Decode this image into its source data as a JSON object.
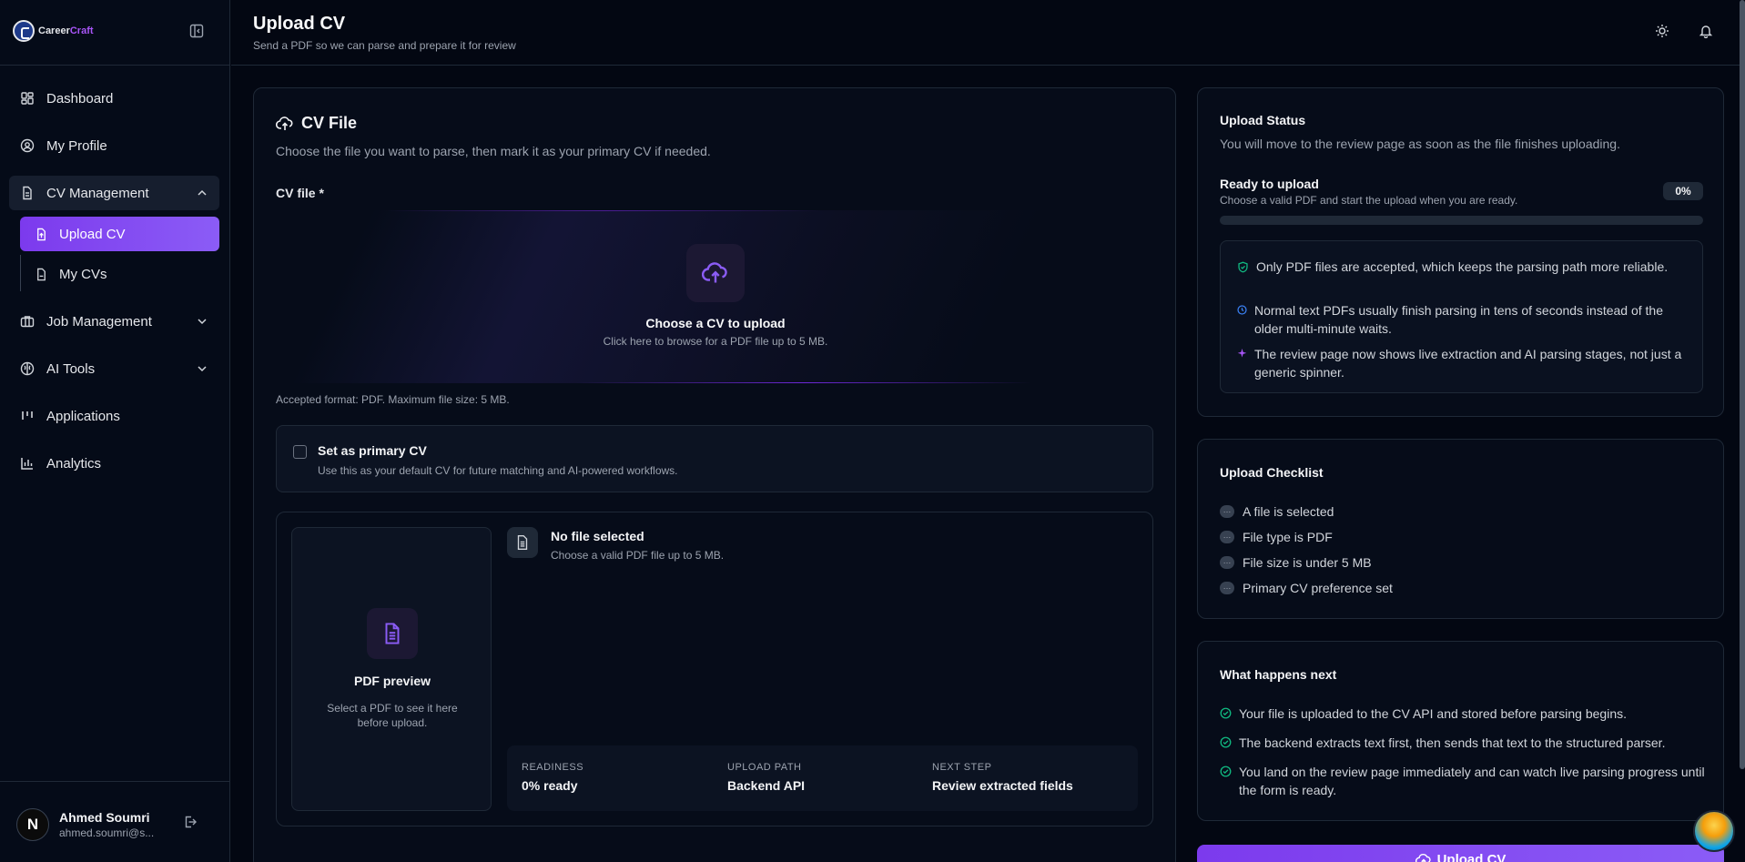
{
  "brand": {
    "name_part1": "Career",
    "name_part2": "Craft"
  },
  "sidebar": {
    "nav": {
      "dashboard": "Dashboard",
      "profile": "My Profile",
      "cv_management": "CV Management",
      "upload_cv": "Upload CV",
      "my_cvs": "My CVs",
      "job_management": "Job Management",
      "ai_tools": "AI Tools",
      "applications": "Applications",
      "analytics": "Analytics"
    },
    "user": {
      "initial": "N",
      "name": "Ahmed Soumri",
      "email": "ahmed.soumri@s..."
    }
  },
  "header": {
    "title": "Upload CV",
    "subtitle": "Send a PDF so we can parse and prepare it for review"
  },
  "cv_file": {
    "title": "CV File",
    "description": "Choose the file you want to parse, then mark it as your primary CV if needed.",
    "label": "CV file *",
    "drop_title": "Choose a CV to upload",
    "drop_sub": "Click here to browse for a PDF file up to 5 MB.",
    "accepted": "Accepted format: PDF. Maximum file size: 5 MB.",
    "primary_title": "Set as primary CV",
    "primary_sub": "Use this as your default CV for future matching and AI-powered workflows.",
    "primary_checked": false,
    "preview_title": "PDF preview",
    "preview_sub": "Select a PDF to see it here before upload.",
    "nofile_title": "No file selected",
    "nofile_sub": "Choose a valid PDF file up to 5 MB.",
    "stats": [
      {
        "label": "READINESS",
        "value": "0% ready"
      },
      {
        "label": "UPLOAD PATH",
        "value": "Backend API"
      },
      {
        "label": "NEXT STEP",
        "value": "Review extracted fields"
      }
    ]
  },
  "upload_status": {
    "title": "Upload Status",
    "description": "You will move to the review page as soon as the file finishes uploading.",
    "ready_title": "Ready to upload",
    "ready_sub": "Choose a valid PDF and start the upload when you are ready.",
    "percent_label": "0%",
    "progress": 0,
    "notes": [
      "Only PDF files are accepted, which keeps the parsing path more reliable.",
      "Normal text PDFs usually finish parsing in tens of seconds instead of the older multi-minute waits.",
      "The review page now shows live extraction and AI parsing stages, not just a generic spinner."
    ]
  },
  "checklist": {
    "title": "Upload Checklist",
    "items": [
      "A file is selected",
      "File type is PDF",
      "File size is under 5 MB",
      "Primary CV preference set"
    ]
  },
  "next": {
    "title": "What happens next",
    "items": [
      "Your file is uploaded to the CV API and stored before parsing begins.",
      "The backend extracts text first, then sends that text to the structured parser.",
      "You land on the review page immediately and can watch live parsing progress until the form is ready."
    ]
  },
  "upload_button": "Upload CV",
  "colors": {
    "accent": "#7c3aed",
    "background": "#030712",
    "success": "#10b981",
    "info": "#3b82f6"
  }
}
